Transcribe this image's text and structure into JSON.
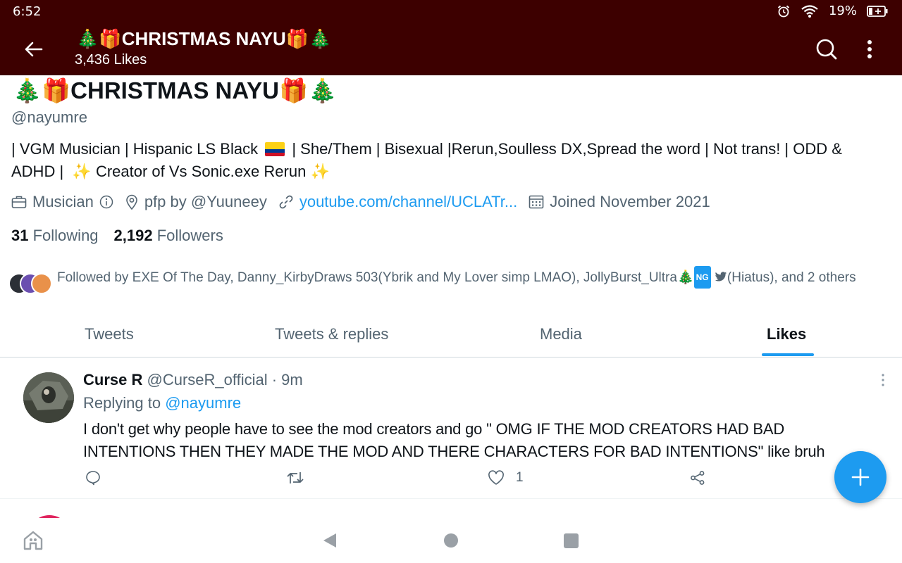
{
  "status_bar": {
    "time": "6:52",
    "battery": "19%",
    "icons": [
      "alarm-icon",
      "wifi-icon",
      "battery-icon"
    ]
  },
  "header": {
    "title": "🎄🎁CHRISTMAS NAYU🎁🎄",
    "subtitle": "3,436 Likes"
  },
  "profile": {
    "name": "🎄🎁CHRISTMAS NAYU🎁🎄",
    "handle": "@nayumre",
    "bio": {
      "part1": "| VGM Musician | Hispanic LS Black",
      "part2": "| She/Them | Bisexual |Rerun,Soulless DX,Spread the word | Not trans! | ODD & ADHD |",
      "sparkle": "✨",
      "part3": "Creator of Vs Sonic.exe Rerun"
    },
    "category": "Musician",
    "location": "pfp by @Yuuneey",
    "link": "youtube.com/channel/UCLATr...",
    "joined": "Joined November 2021",
    "following_count": "31",
    "following_label": "Following",
    "followers_count": "2,192",
    "followers_label": "Followers",
    "followed_by": {
      "text1": "Followed by EXE Of The Day, Danny_KirbyDraws 503(Ybrik and My Lover simp LMAO), JollyBurst_Ultra🎄",
      "badge": "NG",
      "text2": "(Hiatus), and 2 others"
    }
  },
  "tabs": [
    "Tweets",
    "Tweets & replies",
    "Media",
    "Likes"
  ],
  "active_tab": "Likes",
  "tweet": {
    "name": "Curse R",
    "handle": "@CurseR_official",
    "separator": "·",
    "time": "9m",
    "replying_prefix": "Replying to",
    "replying_to": "@nayumre",
    "text": "I don't get why people have to see the mod creators and go \" OMG IF THE MOD CREATORS HAD BAD INTENTIONS THEN THEY MADE THE MOD AND THERE CHARACTERS FOR BAD INTENTIONS\" like bruh",
    "like_count": "1"
  },
  "colors": {
    "header_bg": "#3d0000",
    "accent": "#1d9bf0",
    "secondary_text": "#536471"
  }
}
